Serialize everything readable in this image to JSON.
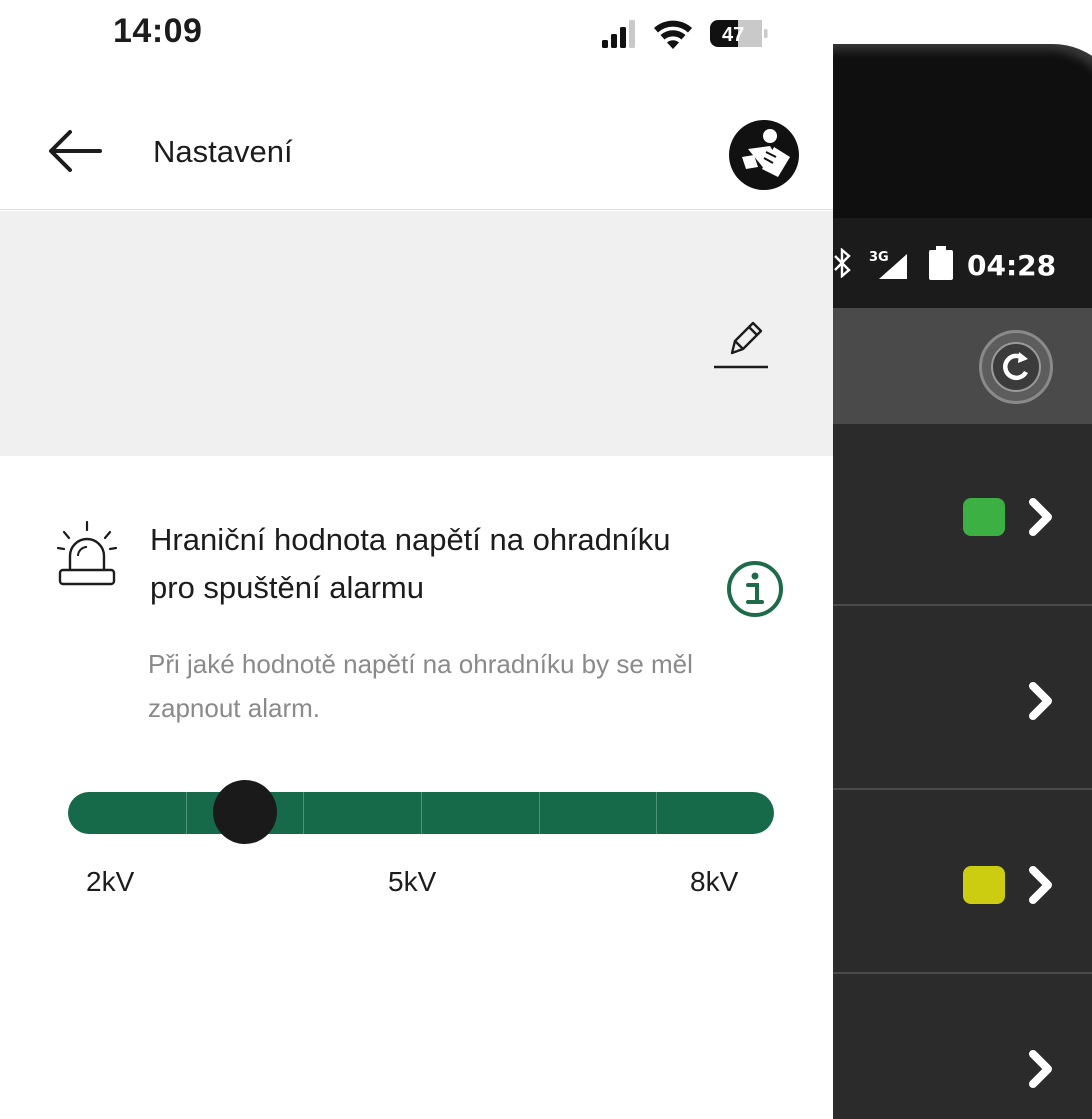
{
  "status_bar": {
    "time": "14:09",
    "battery_level": "47",
    "icons": [
      "cellular-signal-icon",
      "wifi-icon",
      "battery-icon"
    ]
  },
  "app_bar": {
    "title": "Nastavení",
    "back_icon": "arrow-left-icon",
    "manual_icon": "reading-manual-icon"
  },
  "device_card": {
    "edit_icon": "pencil-icon"
  },
  "alarm_setting": {
    "icon": "siren-icon",
    "title": "Hraniční hodnota napětí na ohradníku pro spuštění alarmu",
    "description": "Při jaké hodnotě napětí na ohradníku by se měl zapnout alarm.",
    "info_icon": "info-icon",
    "slider": {
      "min": 2,
      "max": 8,
      "value": 3.5,
      "unit": "kV",
      "steps": 6,
      "labels": {
        "min": "2kV",
        "mid": "5kV",
        "max": "8kV"
      }
    }
  },
  "device_photo": {
    "time": "04:28",
    "network": "3G",
    "rows": [
      {
        "indicator": "green",
        "color": "#3cb043"
      },
      {
        "indicator": "none",
        "color": ""
      },
      {
        "indicator": "yellow",
        "color": "#cccc10"
      },
      {
        "indicator": "none",
        "color": ""
      }
    ]
  },
  "colors": {
    "accent_green": "#166a4a",
    "info_green": "#1e6b4a",
    "muted_text": "#8a8a8a",
    "card_background": "#f0f0f0"
  }
}
